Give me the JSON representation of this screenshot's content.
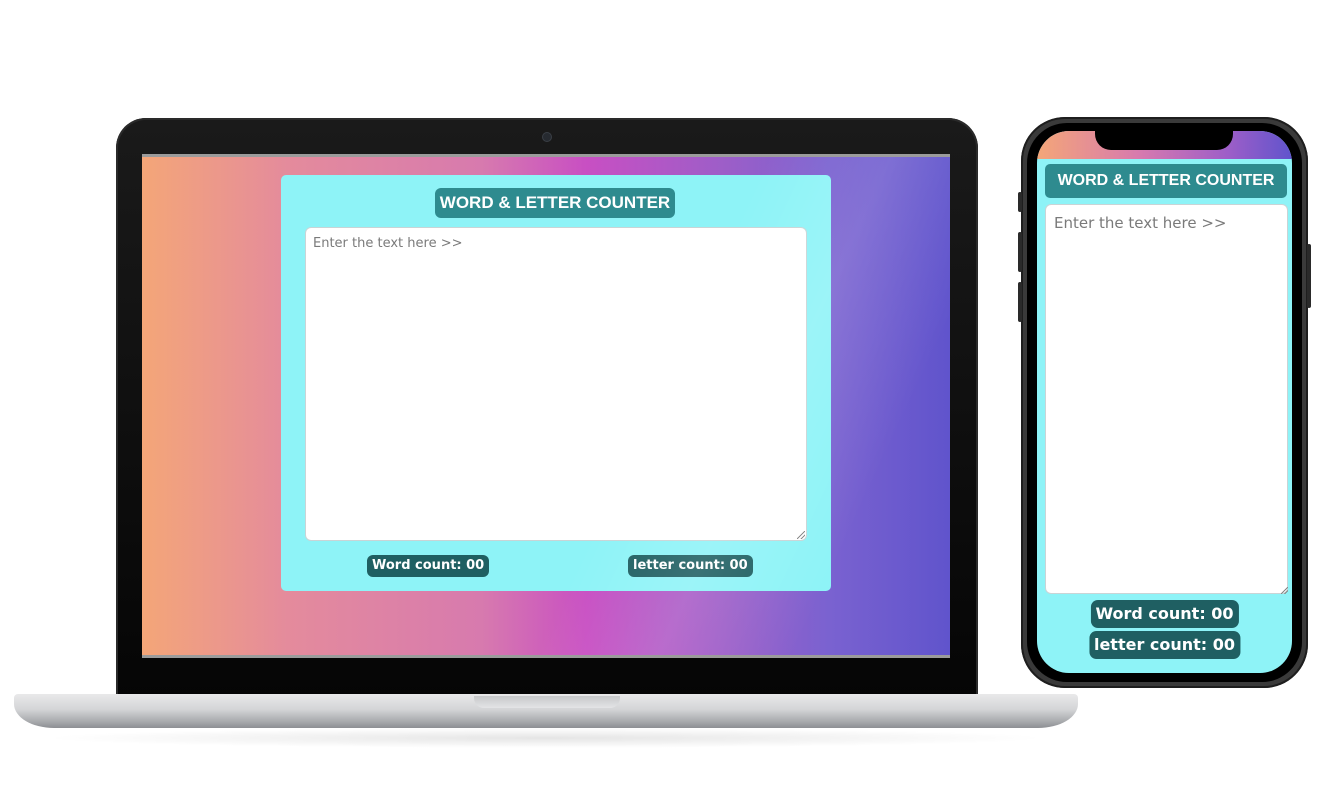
{
  "app": {
    "title": "WORD & LETTER COUNTER",
    "textarea_placeholder": "Enter the text here >>",
    "word_count_label": "Word count: 00",
    "letter_count_label": "letter count: 00"
  },
  "colors": {
    "card_background": "#8ef3f7",
    "title_background": "#2e8b8f",
    "count_badge_background": "#1f5f62",
    "gradient_start": "#f4a678",
    "gradient_mid": "#c84fc3",
    "gradient_end": "#6054cc"
  },
  "devices": [
    "laptop-mockup",
    "phone-mockup"
  ]
}
